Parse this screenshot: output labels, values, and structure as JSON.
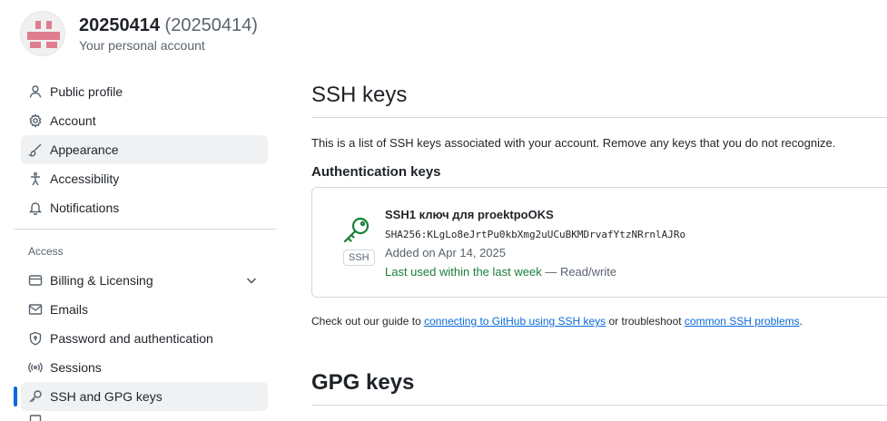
{
  "account": {
    "name": "20250414",
    "login": "(20250414)",
    "subtitle": "Your personal account"
  },
  "sidebar": {
    "items": [
      {
        "label": "Public profile",
        "icon": "person-icon"
      },
      {
        "label": "Account",
        "icon": "gear-icon"
      },
      {
        "label": "Appearance",
        "icon": "paintbrush-icon"
      },
      {
        "label": "Accessibility",
        "icon": "accessibility-icon"
      },
      {
        "label": "Notifications",
        "icon": "bell-icon"
      }
    ],
    "access_heading": "Access",
    "access_items": [
      {
        "label": "Billing & Licensing",
        "icon": "credit-card-icon"
      },
      {
        "label": "Emails",
        "icon": "mail-icon"
      },
      {
        "label": "Password and authentication",
        "icon": "shield-lock-icon"
      },
      {
        "label": "Sessions",
        "icon": "broadcast-icon"
      },
      {
        "label": "SSH and GPG keys",
        "icon": "key-icon"
      }
    ]
  },
  "main": {
    "ssh_title": "SSH keys",
    "intro": "This is a list of SSH keys associated with your account. Remove any keys that you do not recognize.",
    "auth_heading": "Authentication keys",
    "key": {
      "title": "SSH1 ключ для proektpoOKS",
      "fingerprint": "SHA256:KLgLo8eJrtPu0kbXmg2uUCuBKMDrvafYtzNRrnlAJRo",
      "added": "Added on Apr 14, 2025",
      "last_used": "Last used within the last week",
      "access": " — Read/write",
      "badge": "SSH"
    },
    "guide": {
      "prefix": "Check out our guide to ",
      "link1": "connecting to GitHub using SSH keys",
      "middle": " or troubleshoot ",
      "link2": "common SSH problems",
      "suffix": "."
    },
    "gpg_title": "GPG keys"
  },
  "colors": {
    "accent": "#0969da",
    "success": "#1a7f37",
    "avatar": "#e07d8f"
  }
}
